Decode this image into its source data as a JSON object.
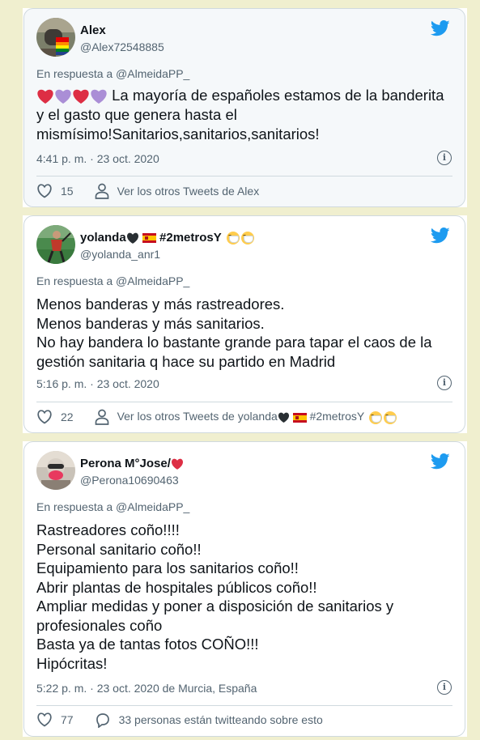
{
  "tweets": [
    {
      "name": "Alex",
      "handle": "@Alex72548885",
      "reply_to": "En respuesta a @AlmeidaPP_",
      "lines": [
        "La mayoría de españoles estamos de la banderita",
        "y el gasto que genera hasta el",
        "mismísimo!Sanitarios,sanitarios,sanitarios!"
      ],
      "leading_emojis": [
        "red-heart",
        "purple-heart",
        "red-heart",
        "purple-heart"
      ],
      "timestamp": "4:41 p. m. · 23 oct. 2020",
      "likes": "15",
      "more_label": "Ver los otros Tweets de Alex"
    },
    {
      "name": "yolanda",
      "name_suffix": "#2metrosY",
      "handle": "@yolanda_anr1",
      "reply_to": "En respuesta a @AlmeidaPP_",
      "lines": [
        "Menos banderas y más rastreadores.",
        "Menos banderas y más sanitarios.",
        "No hay bandera lo bastante grande para tapar el caos de la",
        "gestión sanitaria q hace su partido en Madrid"
      ],
      "timestamp": "5:16 p. m. · 23 oct. 2020",
      "likes": "22",
      "more_label": "Ver los otros Tweets de yolanda",
      "more_suffix": "#2metrosY"
    },
    {
      "name": "Perona M°Jose/",
      "handle": "@Perona10690463",
      "reply_to": "En respuesta a @AlmeidaPP_",
      "lines": [
        "Rastreadores coño!!!!",
        "Personal sanitario coño!!",
        "Equipamiento para los sanitarios coño!!",
        "Abrir plantas de hospitales públicos coño!!",
        "Ampliar medidas y poner a disposición de sanitarios y",
        "profesionales coño",
        "Basta ya de tantas fotos COÑO!!!",
        "Hipócritas!"
      ],
      "timestamp": "5:22 p. m. · 23 oct. 2020 de Murcia, España",
      "likes": "77",
      "more_label": "33 personas están twitteando sobre esto"
    }
  ],
  "colors": {
    "twitter_blue": "#1d9bf0",
    "text": "#0f1419",
    "muted": "#536471",
    "border": "#cfd9de",
    "page_bg": "#f0efcf"
  }
}
